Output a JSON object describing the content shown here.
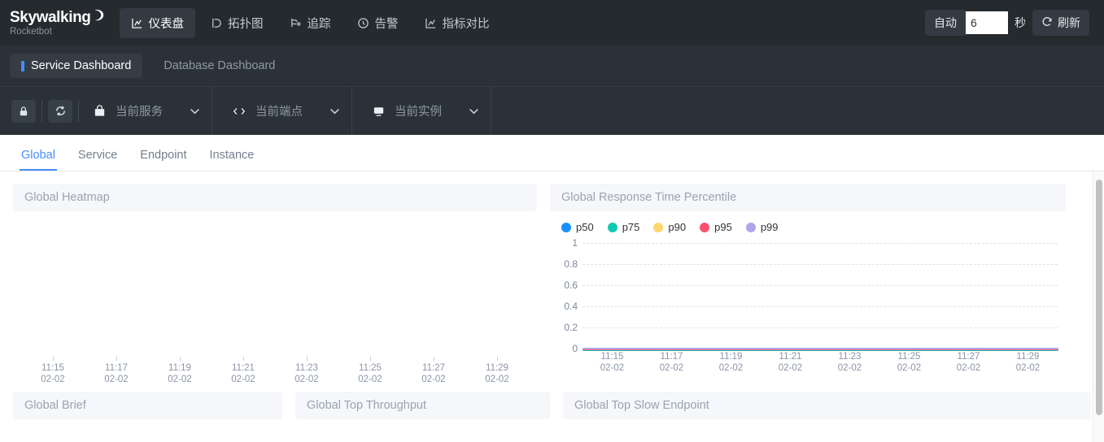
{
  "brand": {
    "name": "Skywalking",
    "sub": "Rocketbot"
  },
  "nav": {
    "items": [
      {
        "label": "仪表盘",
        "icon": "chart-icon",
        "active": true
      },
      {
        "label": "拓扑图",
        "icon": "topology-icon",
        "active": false
      },
      {
        "label": "追踪",
        "icon": "trace-icon",
        "active": false
      },
      {
        "label": "告警",
        "icon": "alarm-icon",
        "active": false
      },
      {
        "label": "指标对比",
        "icon": "compare-icon",
        "active": false
      }
    ]
  },
  "refresh": {
    "auto_label": "自动",
    "interval_value": "6",
    "interval_placeholder": "",
    "unit_label": "秒",
    "refresh_label": "刷新",
    "refresh_icon": "refresh-icon"
  },
  "dashboards": [
    {
      "label": "Service Dashboard",
      "active": true
    },
    {
      "label": "Database Dashboard",
      "active": false
    }
  ],
  "selectors": {
    "lock_icon": "lock-icon",
    "reload_icon": "reload-icon",
    "groups": [
      {
        "icon": "service-bag-icon",
        "label": "当前服务",
        "caret": "⌄"
      },
      {
        "icon": "endpoint-code-icon",
        "label": "当前端点",
        "caret": "⌄"
      },
      {
        "icon": "instance-monitor-icon",
        "label": "当前实例",
        "caret": "⌄"
      }
    ]
  },
  "subtabs": [
    {
      "label": "Global",
      "active": true
    },
    {
      "label": "Service",
      "active": false
    },
    {
      "label": "Endpoint",
      "active": false
    },
    {
      "label": "Instance",
      "active": false
    }
  ],
  "panels": {
    "heatmap": {
      "title": "Global Heatmap"
    },
    "percentile": {
      "title": "Global Response Time Percentile"
    },
    "brief": {
      "title": "Global Brief"
    },
    "throughput": {
      "title": "Global Top Throughput"
    },
    "slow_endpoint": {
      "title": "Global Top Slow Endpoint"
    }
  },
  "colors": {
    "accent": "#448dfe",
    "topbar_bg": "#252a2f",
    "selbar_bg": "#2b3138",
    "panel_head_bg": "#f5f7fa",
    "panel_title": "#9aa3b0"
  },
  "chart_data": [
    {
      "type": "line",
      "title": "Global Response Time Percentile",
      "xlabel": "",
      "ylabel": "",
      "ylim": [
        0,
        1
      ],
      "yticks": [
        1,
        0.8,
        0.6,
        0.4,
        0.2,
        0
      ],
      "grid": true,
      "legend_position": "top-left",
      "x": [
        "11:15 02-02",
        "11:17 02-02",
        "11:19 02-02",
        "11:21 02-02",
        "11:23 02-02",
        "11:25 02-02",
        "11:27 02-02",
        "11:29 02-02"
      ],
      "series": [
        {
          "name": "p50",
          "color": "#1890ff",
          "values": [
            0,
            0,
            0,
            0,
            0,
            0,
            0,
            0
          ]
        },
        {
          "name": "p75",
          "color": "#0fc9b0",
          "values": [
            0,
            0,
            0,
            0,
            0,
            0,
            0,
            0
          ]
        },
        {
          "name": "p90",
          "color": "#ffd56e",
          "values": [
            0,
            0,
            0,
            0,
            0,
            0,
            0,
            0
          ]
        },
        {
          "name": "p95",
          "color": "#ff4f6e",
          "values": [
            0,
            0,
            0,
            0,
            0,
            0,
            0,
            0
          ]
        },
        {
          "name": "p99",
          "color": "#aea5ea",
          "values": [
            0,
            0,
            0,
            0,
            0,
            0,
            0,
            0
          ]
        }
      ]
    },
    {
      "type": "heatmap",
      "title": "Global Heatmap",
      "xlabel": "",
      "ylabel": "",
      "grid": false,
      "x": [
        "11:15 02-02",
        "11:17 02-02",
        "11:19 02-02",
        "11:21 02-02",
        "11:23 02-02",
        "11:25 02-02",
        "11:27 02-02",
        "11:29 02-02"
      ],
      "cells": []
    }
  ]
}
